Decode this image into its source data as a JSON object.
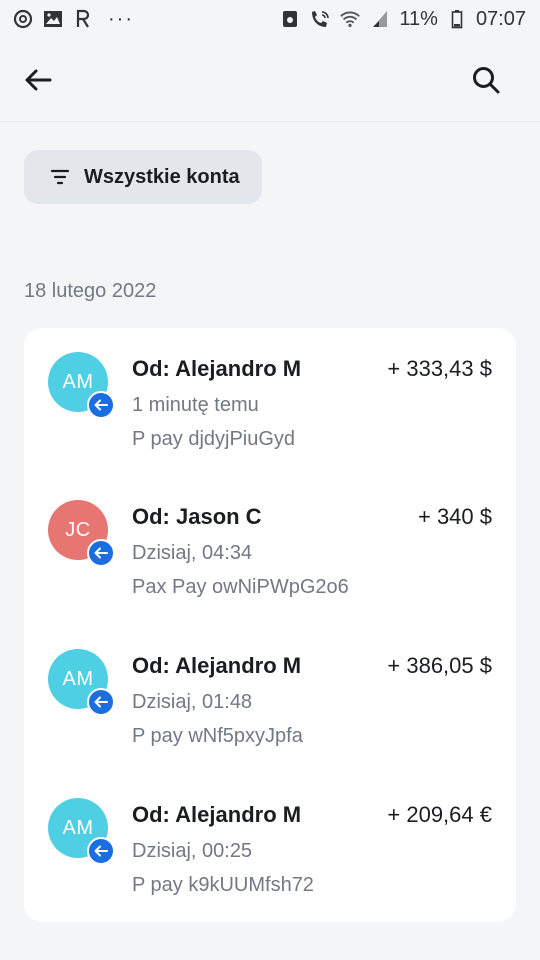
{
  "status_bar": {
    "battery": "11%",
    "time": "07:07",
    "icons": [
      "app-icon",
      "image-icon",
      "r-icon",
      "more-dots-icon",
      "cast-icon",
      "wifi-call-icon",
      "wifi-icon",
      "signal-icon",
      "battery-icon"
    ]
  },
  "header": {
    "back_icon": "arrow-left-icon",
    "search_icon": "search-icon"
  },
  "filter": {
    "label": "Wszystkie konta",
    "icon": "filter-icon"
  },
  "date_group": "18 lutego 2022",
  "transactions": [
    {
      "initials": "AM",
      "avatar_color": "#4fcfe3",
      "name": "Od: Alejandro M",
      "amount": "+ 333,43 $",
      "time": "1 minutę temu",
      "reference": "P pay djdyjPiuGyd"
    },
    {
      "initials": "JC",
      "avatar_color": "#e77572",
      "name": "Od: Jason C",
      "amount": "+ 340 $",
      "time": "Dzisiaj, 04:34",
      "reference": "Pax Pay owNiPWpG2o6"
    },
    {
      "initials": "AM",
      "avatar_color": "#4fcfe3",
      "name": "Od: Alejandro M",
      "amount": "+ 386,05 $",
      "time": "Dzisiaj, 01:48",
      "reference": "P pay wNf5pxyJpfa"
    },
    {
      "initials": "AM",
      "avatar_color": "#4fcfe3",
      "name": "Od: Alejandro M",
      "amount": "+ 209,64 €",
      "time": "Dzisiaj, 00:25",
      "reference": "P pay k9kUUMfsh72"
    }
  ],
  "colors": {
    "background": "#f4f5f7",
    "badge_blue": "#1a6ee0",
    "chip": "#e3e6eb"
  }
}
